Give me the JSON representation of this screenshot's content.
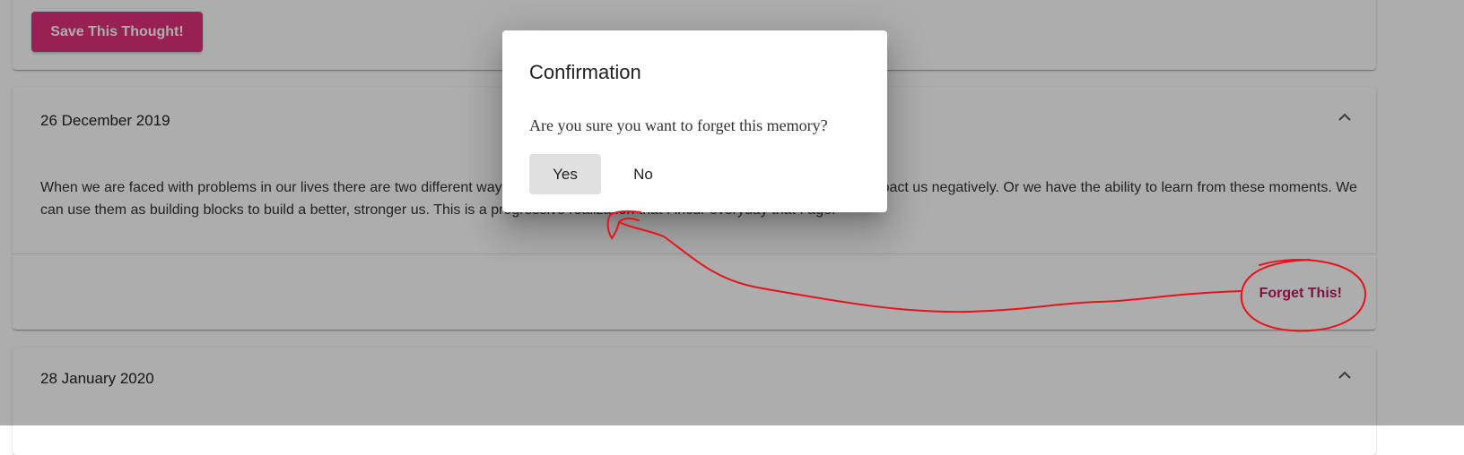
{
  "top_card": {
    "save_label": "Save This Thought!"
  },
  "memories": [
    {
      "date": "26 December 2019",
      "text": "When we are faced with problems in our lives there are two different ways we can react. We can let them hurt us; we can let them impact us negatively. Or we have the ability to learn from these moments. We can use them as building blocks to build a better, stronger us. This is a progressive realization that I incur everyday that I age.",
      "forget_label": "Forget This!"
    },
    {
      "date": "28 January 2020"
    }
  ],
  "dialog": {
    "title": "Confirmation",
    "message": "Are you sure you want to forget this memory?",
    "yes_label": "Yes",
    "no_label": "No"
  },
  "icons": {
    "expand": "chevron-up-icon"
  },
  "colors": {
    "accent": "#e0307a",
    "forget_text": "#c2185b",
    "annotation": "#e8121c",
    "backdrop": "rgba(0,0,0,0.32)"
  }
}
